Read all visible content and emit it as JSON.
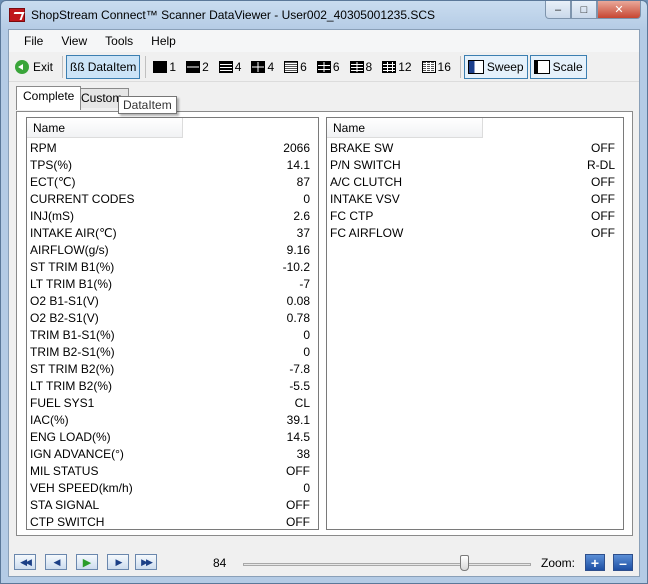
{
  "window": {
    "title": "ShopStream Connect™ Scanner DataViewer - User002_40305001235.SCS",
    "controls": {
      "minimize": "–",
      "maximize": "□",
      "close": "✕"
    }
  },
  "menu": [
    "File",
    "View",
    "Tools",
    "Help"
  ],
  "toolbar": {
    "exit": "Exit",
    "dataitem": "DataItem",
    "dataitem_glyph": "ßß",
    "layouts": [
      "1",
      "2",
      "4",
      "4",
      "6",
      "6",
      "8",
      "12",
      "16"
    ],
    "sweep": "Sweep",
    "scale": "Scale"
  },
  "tabs": {
    "complete": "Complete",
    "custom": "Custom"
  },
  "tooltip": "DataItem",
  "left_pane": {
    "header": "Name",
    "rows": [
      {
        "name": "RPM",
        "value": "2066"
      },
      {
        "name": "TPS(%)",
        "value": "14.1"
      },
      {
        "name": "ECT(℃)",
        "value": "87"
      },
      {
        "name": "CURRENT CODES",
        "value": "0"
      },
      {
        "name": "INJ(mS)",
        "value": "2.6"
      },
      {
        "name": "INTAKE AIR(℃)",
        "value": "37"
      },
      {
        "name": "AIRFLOW(g/s)",
        "value": "9.16"
      },
      {
        "name": "ST TRIM B1(%)",
        "value": "-10.2"
      },
      {
        "name": "LT TRIM B1(%)",
        "value": "-7"
      },
      {
        "name": "O2 B1-S1(V)",
        "value": "0.08"
      },
      {
        "name": "O2 B2-S1(V)",
        "value": "0.78"
      },
      {
        "name": "TRIM B1-S1(%)",
        "value": "0"
      },
      {
        "name": "TRIM B2-S1(%)",
        "value": "0"
      },
      {
        "name": "ST TRIM B2(%)",
        "value": "-7.8"
      },
      {
        "name": "LT TRIM B2(%)",
        "value": "-5.5"
      },
      {
        "name": "FUEL SYS1",
        "value": "CL"
      },
      {
        "name": "IAC(%)",
        "value": "39.1"
      },
      {
        "name": "ENG LOAD(%)",
        "value": "14.5"
      },
      {
        "name": "IGN ADVANCE(°)",
        "value": "38"
      },
      {
        "name": "MIL STATUS",
        "value": "OFF"
      },
      {
        "name": "VEH SPEED(km/h)",
        "value": "0"
      },
      {
        "name": "STA SIGNAL",
        "value": "OFF"
      },
      {
        "name": "CTP SWITCH",
        "value": "OFF"
      }
    ]
  },
  "right_pane": {
    "header": "Name",
    "rows": [
      {
        "name": "BRAKE SW",
        "value": "OFF"
      },
      {
        "name": "P/N SWITCH",
        "value": "R-DL"
      },
      {
        "name": "A/C CLUTCH",
        "value": "OFF"
      },
      {
        "name": "INTAKE VSV",
        "value": "OFF"
      },
      {
        "name": "FC CTP",
        "value": "OFF"
      },
      {
        "name": "FC AIRFLOW",
        "value": "OFF"
      }
    ]
  },
  "playback": {
    "first": "◀◀",
    "prev": "◀",
    "play": "▶",
    "next": "▶",
    "last": "▶▶",
    "frame": "84",
    "position": 0.77,
    "zoom_label": "Zoom:",
    "zoom_in": "+",
    "zoom_out": "–"
  }
}
